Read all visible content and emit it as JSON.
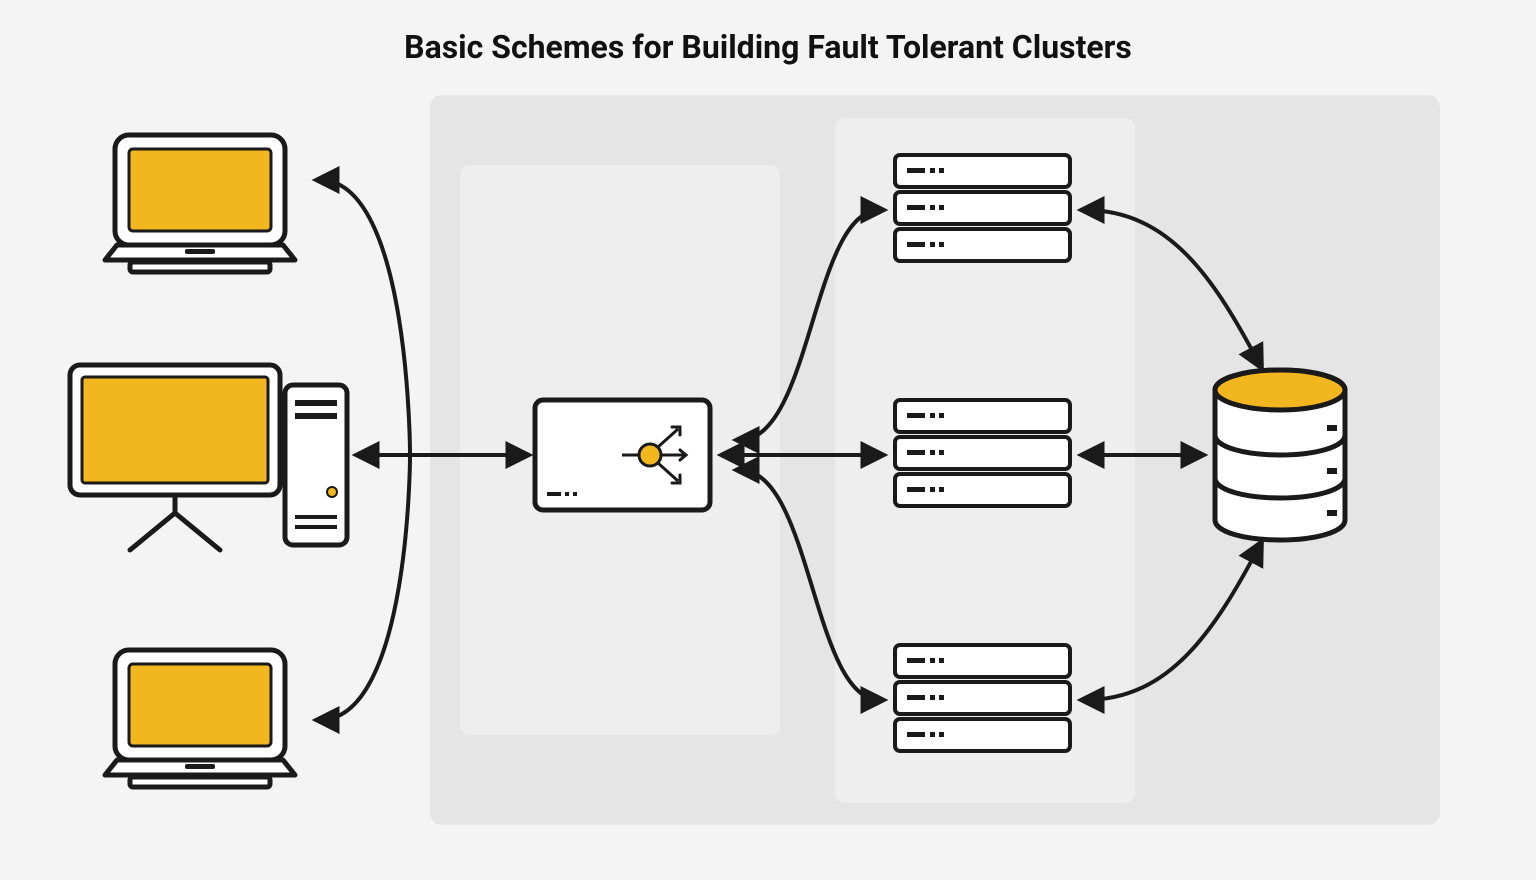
{
  "title": "Basic Schemes for Building Fault Tolerant Clusters",
  "colors": {
    "accent": "#f2b61e",
    "line": "#1a1a1a",
    "panel_outer": "#e5e5e5",
    "panel_inner": "#eeeeee",
    "bg": "#f4f4f4",
    "white": "#ffffff"
  },
  "nodes": {
    "clients": [
      {
        "type": "laptop"
      },
      {
        "type": "desktop"
      },
      {
        "type": "laptop"
      }
    ],
    "load_balancer": {
      "type": "balancer"
    },
    "servers": [
      {
        "type": "server"
      },
      {
        "type": "server"
      },
      {
        "type": "server"
      }
    ],
    "database": {
      "type": "database"
    }
  }
}
